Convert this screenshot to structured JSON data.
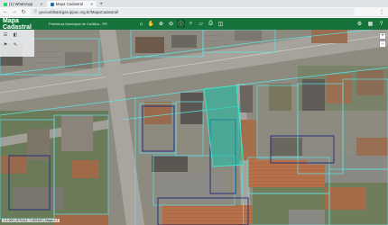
{
  "browser": {
    "tabs": [
      {
        "label": "(1) WhatsApp",
        "active": false,
        "favicon_color": "#25d366"
      },
      {
        "label": "Mapa Cadastral",
        "active": true,
        "favicon_color": "#1a6fb5"
      }
    ],
    "new_tab_label": "+",
    "url": "geocuritibasirgas.ippuc.org.br/MapaCadastral/",
    "menu_label": "⋮"
  },
  "app": {
    "title": "Mapa Cadastral",
    "subtitle": "Prefeitura Municipal de Curitiba - PR",
    "header_color": "#16733c",
    "parcel_highlight_color": "#19c2a8",
    "toolbar": [
      {
        "icon": "home-icon",
        "glyph": "⌂",
        "selected": false
      },
      {
        "icon": "pan-icon",
        "glyph": "✋",
        "selected": false
      },
      {
        "icon": "zoom-in-icon",
        "glyph": "⊕",
        "selected": false
      },
      {
        "icon": "zoom-out-icon",
        "glyph": "⊖",
        "selected": false
      },
      {
        "icon": "info-icon",
        "glyph": "ⓘ",
        "selected": true
      },
      {
        "icon": "search-icon",
        "glyph": "⌕",
        "selected": false
      },
      {
        "icon": "measure-icon",
        "glyph": "▱",
        "selected": false
      },
      {
        "icon": "print-icon",
        "glyph": "⎙",
        "selected": false
      },
      {
        "icon": "layers-icon",
        "glyph": "◫",
        "selected": false
      }
    ],
    "header_right": [
      {
        "icon": "settings-icon",
        "glyph": "⚙"
      },
      {
        "icon": "grid-icon",
        "glyph": "▦"
      },
      {
        "icon": "help-icon",
        "glyph": "?"
      }
    ],
    "left_panel": [
      {
        "icon": "layers-list-icon",
        "glyph": "☰"
      },
      {
        "icon": "legend-icon",
        "glyph": "◧"
      },
      {
        "icon": "bookmark-icon",
        "glyph": "⚑"
      },
      {
        "icon": "draw-icon",
        "glyph": "✎"
      }
    ],
    "coordinates": "1:1.000 | 673.412, 7.183.519 | Mapa 1 1"
  }
}
